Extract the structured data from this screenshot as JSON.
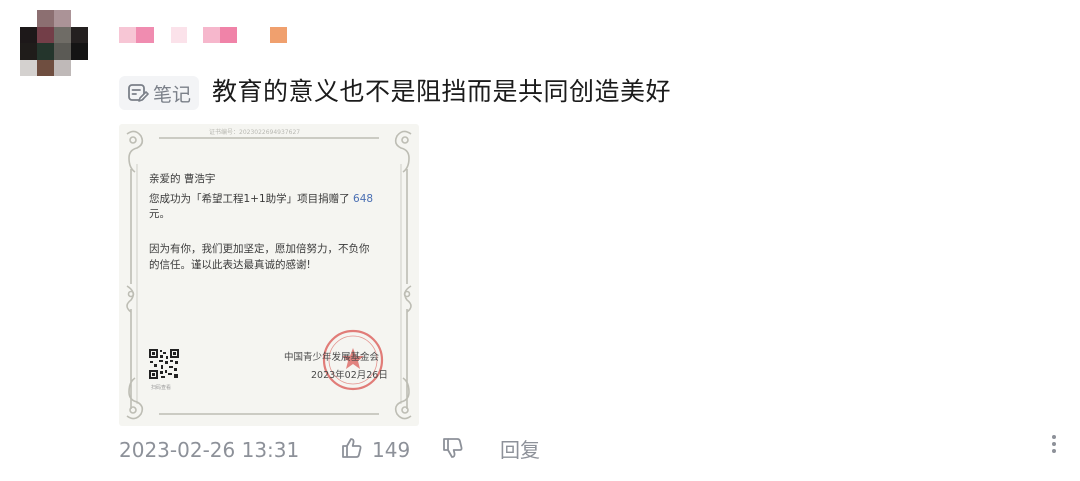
{
  "comment": {
    "user": {
      "avatar_icon": "pixelated-avatar",
      "avatar_colors": [
        [
          "#ffffff",
          "#8c6f71",
          "#ab9397",
          "#ffffff"
        ],
        [
          "#1d1819",
          "#733e48",
          "#6f6c66",
          "#242020"
        ],
        [
          "#1f1c1a",
          "#24352c",
          "#5b5a55",
          "#141414"
        ],
        [
          "#d4d1cf",
          "#6f4e40",
          "#bfb9b8",
          "#ffffff"
        ]
      ],
      "name_block_colors": [
        "#f7c6d5",
        "#f08cb0",
        "#fbe2ea",
        "#f6b7cc",
        "#f083a8",
        "#f0a06e"
      ]
    },
    "tag_label": "笔记",
    "tag_icon": "note-edit-icon",
    "text": "教育的意义也不是阻挡而是共同创造美好",
    "timestamp": "2023-02-26 13:31",
    "like_icon": "thumbs-up-icon",
    "like_count": "149",
    "dislike_icon": "thumbs-down-icon",
    "reply_label": "回复",
    "more_icon": "more-vertical-icon",
    "colors": {
      "meta_text": "#8d9199",
      "tag_bg": "#f3f4f6"
    }
  },
  "certificate": {
    "serial": "证书编号：2023022694937627",
    "greeting": "亲爱的 曹浩宇",
    "line1": "您成功为「希望工程1+1助学」项目捐赠了",
    "amount": "648",
    "unit": "元。",
    "line2": "因为有你，我们更加坚定，愿加倍努力，不负你",
    "line3": "的信任。谨以此表达最真诚的感谢!",
    "org": "中国青少年发展基金会",
    "date": "2023年02月26日",
    "qr_caption": "扫码查看",
    "seal_icon": "red-seal-stamp",
    "colors": {
      "paper": "#f5f5f1",
      "seal": "#d9534f",
      "amount": "#4a6fb3"
    }
  }
}
